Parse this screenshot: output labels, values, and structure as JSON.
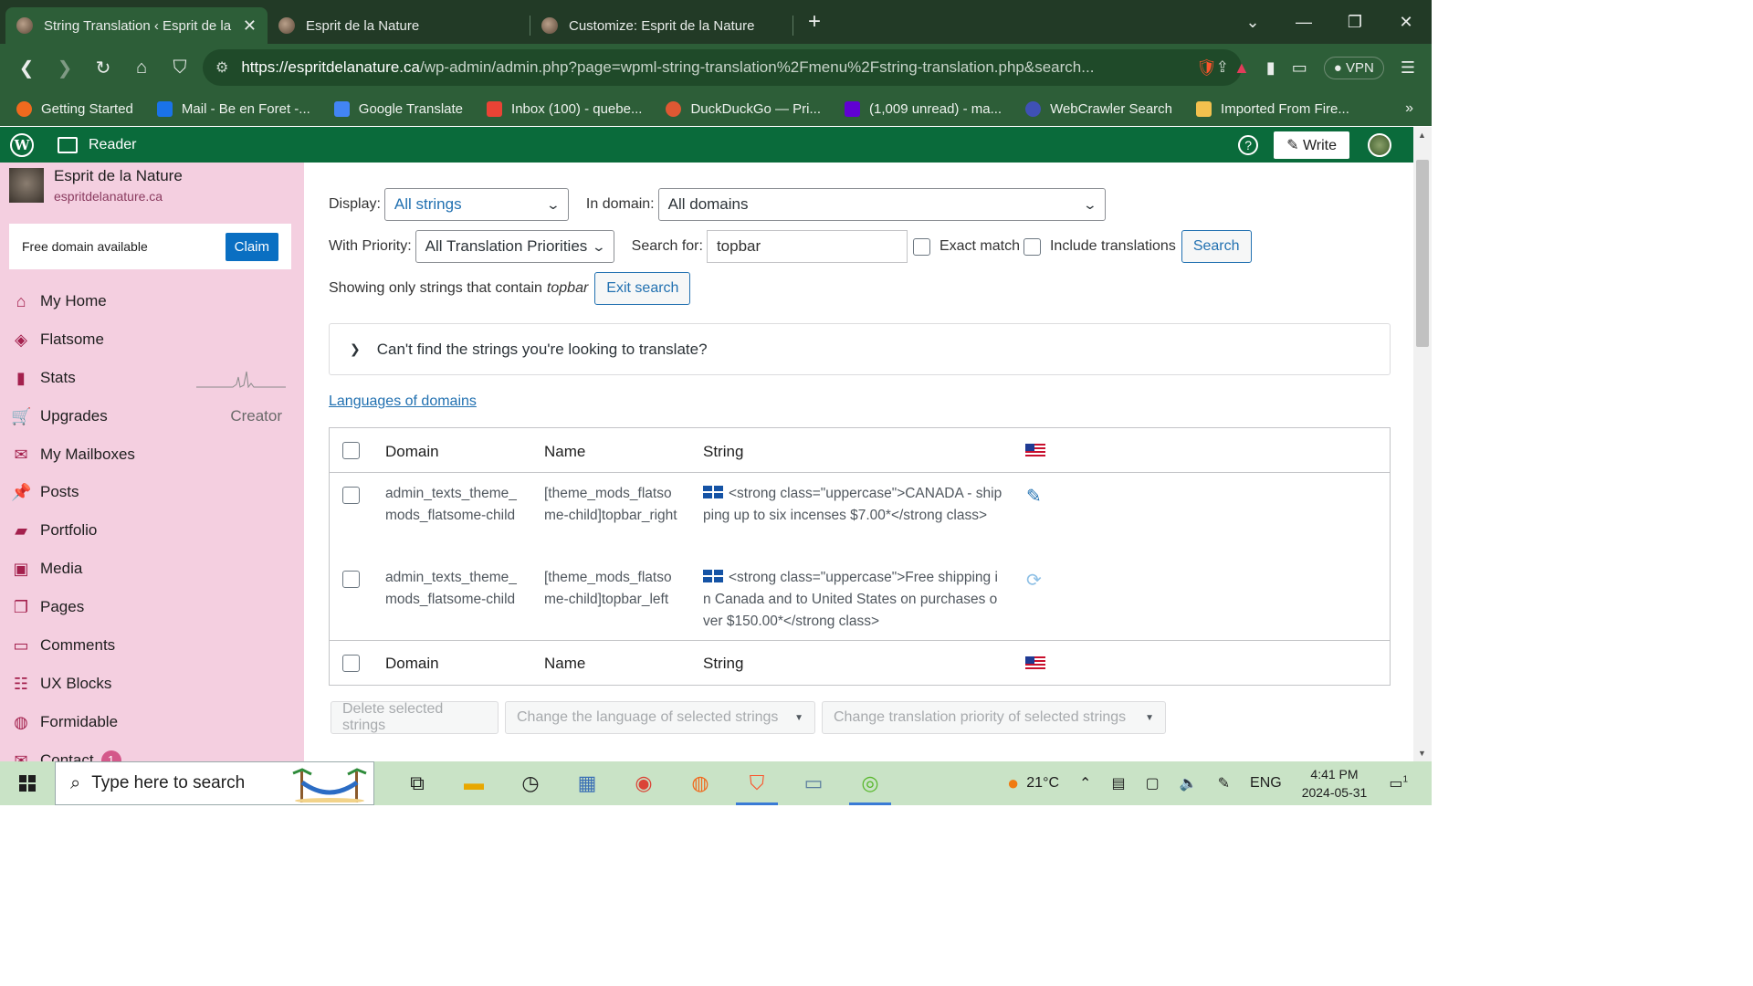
{
  "browser": {
    "tabs": [
      {
        "title": "String Translation ‹ Esprit de la Nature",
        "active": true
      },
      {
        "title": "Esprit de la Nature",
        "active": false
      },
      {
        "title": "Customize: Esprit de la Nature",
        "active": false
      }
    ],
    "url_host": "https://espritdelanature.ca",
    "url_path": "/wp-admin/admin.php?page=wpml-string-translation%2Fmenu%2Fstring-translation.php&search...",
    "vpn_label": "VPN",
    "brave_badge": "5",
    "bookmarks": [
      {
        "label": "Getting Started",
        "color": "#f06a1e"
      },
      {
        "label": "Mail - Be en Foret -...",
        "color": "#1a73e8"
      },
      {
        "label": "Google Translate",
        "color": "#4285f4"
      },
      {
        "label": "Inbox (100) - quebe...",
        "color": "#ea4335"
      },
      {
        "label": "DuckDuckGo — Pri...",
        "color": "#de5833"
      },
      {
        "label": "(1,009 unread) - ma...",
        "color": "#6001d2"
      },
      {
        "label": "WebCrawler Search",
        "color": "#3f51b5"
      },
      {
        "label": "Imported From Fire...",
        "color": "#f2c14e"
      }
    ]
  },
  "masterbar": {
    "reader_label": "Reader",
    "write_label": "Write",
    "help_label": "?"
  },
  "sidebar": {
    "site_name": "Esprit de la Nature",
    "site_url": "espritdelanature.ca",
    "free_domain_text": "Free domain available",
    "claim_label": "Claim",
    "items": [
      {
        "label": "My Home",
        "icon": "home-icon",
        "glyph": "⌂"
      },
      {
        "label": "Flatsome",
        "icon": "diamond-icon",
        "glyph": "◈"
      },
      {
        "label": "Stats",
        "icon": "stats-icon",
        "glyph": "▮"
      },
      {
        "label": "Upgrades",
        "icon": "cart-icon",
        "glyph": "🛒",
        "right": "Creator"
      },
      {
        "label": "My Mailboxes",
        "icon": "mail-icon",
        "glyph": "✉"
      },
      {
        "label": "Posts",
        "icon": "pin-icon",
        "glyph": "📌"
      },
      {
        "label": "Portfolio",
        "icon": "folder-icon",
        "glyph": "▰"
      },
      {
        "label": "Media",
        "icon": "media-icon",
        "glyph": "▣"
      },
      {
        "label": "Pages",
        "icon": "pages-icon",
        "glyph": "❐"
      },
      {
        "label": "Comments",
        "icon": "comment-icon",
        "glyph": "▭"
      },
      {
        "label": "UX Blocks",
        "icon": "blocks-icon",
        "glyph": "☷"
      },
      {
        "label": "Formidable",
        "icon": "formidable-icon",
        "glyph": "◍"
      },
      {
        "label": "Contact",
        "icon": "mail-icon",
        "glyph": "✉",
        "badge": "1"
      }
    ]
  },
  "filters": {
    "display_label": "Display:",
    "display_value": "All strings",
    "domain_label": "In domain:",
    "domain_value": "All domains",
    "priority_label": "With Priority:",
    "priority_value": "All Translation Priorities",
    "search_label": "Search for:",
    "search_value": "topbar",
    "exact_match_label": "Exact match",
    "include_translations_label": "Include translations",
    "search_button": "Search",
    "showing_prefix": "Showing only strings that contain",
    "showing_term": "topbar",
    "exit_search": "Exit search"
  },
  "help_box": {
    "text": "Can't find the strings you're looking to translate?"
  },
  "languages_link": "Languages of domains",
  "table": {
    "headers": {
      "domain": "Domain",
      "name": "Name",
      "string": "String"
    },
    "rows": [
      {
        "domain": "admin_texts_theme_mods_flatsome-child",
        "name": "[theme_mods_flatsome-child]topbar_right",
        "string": "<strong class=\"uppercase\">CANADA - shipping up to six incenses $7.00*</strong class>",
        "status_icon": "edit-icon"
      },
      {
        "domain": "admin_texts_theme_mods_flatsome-child",
        "name": "[theme_mods_flatsome-child]topbar_left",
        "string": "<strong class=\"uppercase\">Free shipping in Canada and to United States on purchases over $150.00*</strong class>",
        "status_icon": "sync-icon"
      }
    ]
  },
  "bulk_actions": {
    "delete": "Delete selected strings",
    "change_language": "Change the language of selected strings",
    "change_priority": "Change translation priority of selected strings"
  },
  "taskbar": {
    "search_placeholder": "Type here to search",
    "weather": "21°C",
    "lang": "ENG",
    "time": "4:41 PM",
    "date": "2024-05-31",
    "notifications": "1"
  }
}
